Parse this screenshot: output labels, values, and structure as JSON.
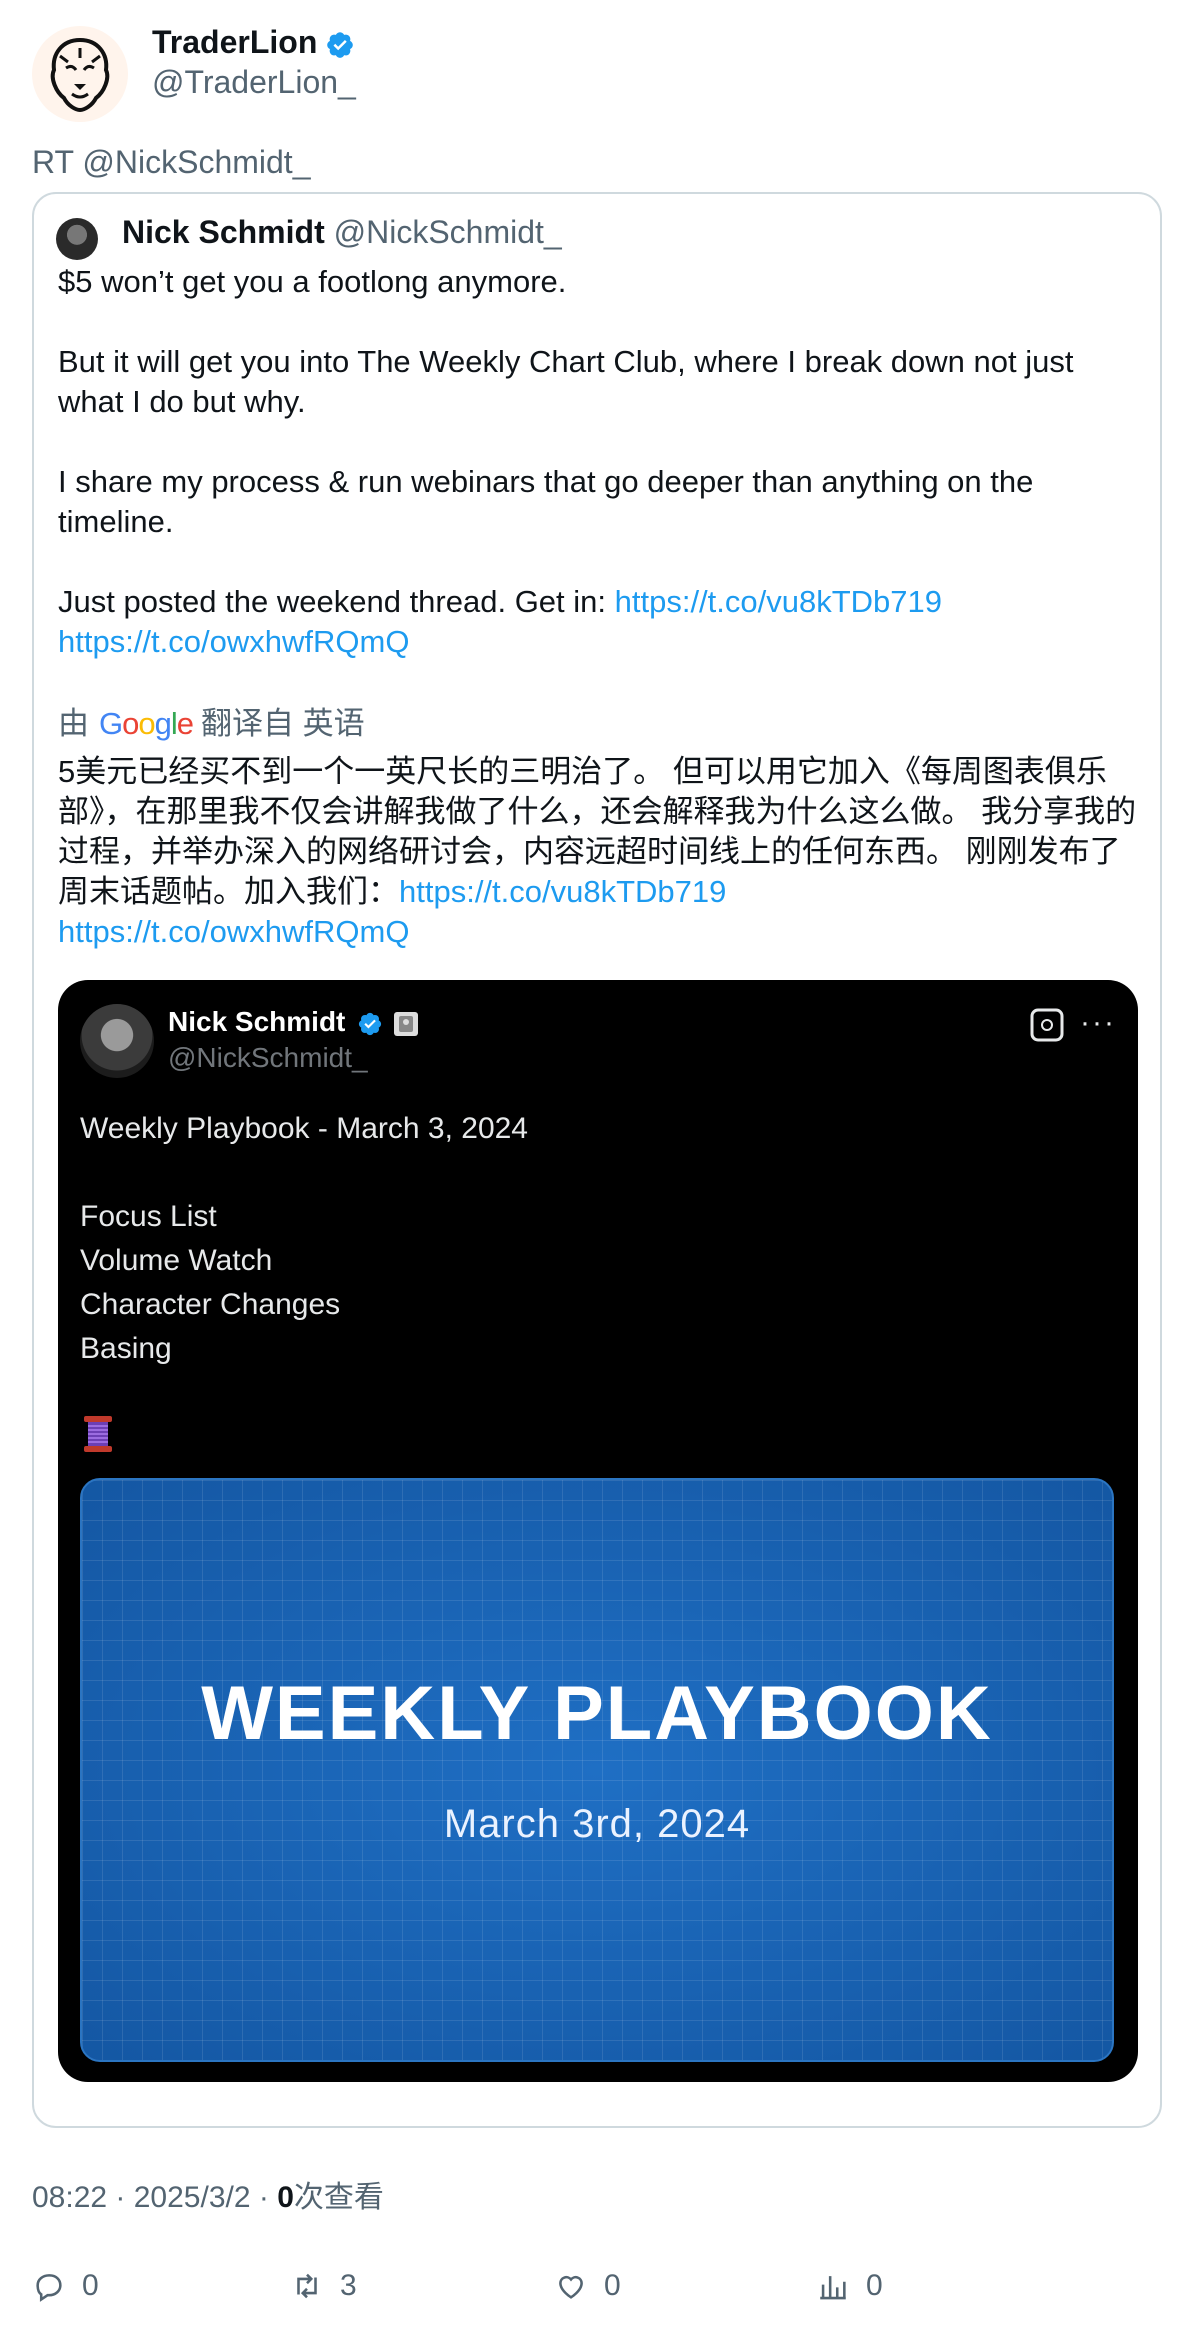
{
  "post": {
    "author_name": "TraderLion",
    "author_handle": "@TraderLion_",
    "retweet_line": "RT @NickSchmidt_"
  },
  "quote": {
    "author_name": "Nick Schmidt",
    "author_handle": "@NickSchmidt_",
    "para1": "$5 won’t get you a footlong anymore.",
    "para2": "But it will get you into The Weekly Chart Club, where I break down not just what I do but why.",
    "para3": "I share my process & run webinars that go deeper than anything on the timeline.",
    "para4_text": "Just posted the weekend thread. Get in: ",
    "link1": "https://t.co/vu8kTDb719",
    "link2": "https://t.co/owxhwfRQmQ",
    "translation": {
      "prefix": "由",
      "provider": "Google",
      "suffix": "翻译自 英语",
      "text": "5美元已经买不到一个一英尺长的三明治了。 但可以用它加入《每周图表俱乐部》，在那里我不仅会讲解我做了什么，还会解释我为什么这么做。 我分享我的过程，并举办深入的网络研讨会，内容远超时间线上的任何东西。 刚刚发布了周末话题帖。加入我们：",
      "link1": "https://t.co/vu8kTDb719",
      "link2": "https://t.co/owxhwfRQmQ"
    },
    "media": {
      "author_name": "Nick Schmidt",
      "author_handle": "@NickSchmidt_",
      "more": "···",
      "title": "Weekly Playbook - March 3, 2024",
      "items": [
        "Focus List",
        "Volume Watch",
        "Character Changes",
        "Basing"
      ],
      "thread_emoji": "🧵",
      "card_title": "WEEKLY PLAYBOOK",
      "card_date": "March 3rd, 2024"
    }
  },
  "footer": {
    "time": "08:22",
    "date": "2025/3/2",
    "views_count": "0",
    "views_label": "次查看",
    "replies": "0",
    "retweets": "3",
    "likes": "0",
    "analytics": "0"
  },
  "colors": {
    "link": "#1d9bf0",
    "verified": "#1d9bf0",
    "secondary_text": "#536471",
    "card_blue": "#1a62b0"
  },
  "icons": [
    "lion-logo-icon",
    "verified-badge-icon",
    "grok-icon",
    "more-icon",
    "thread-spool-icon",
    "reply-icon",
    "retweet-icon",
    "like-icon",
    "analytics-icon"
  ]
}
